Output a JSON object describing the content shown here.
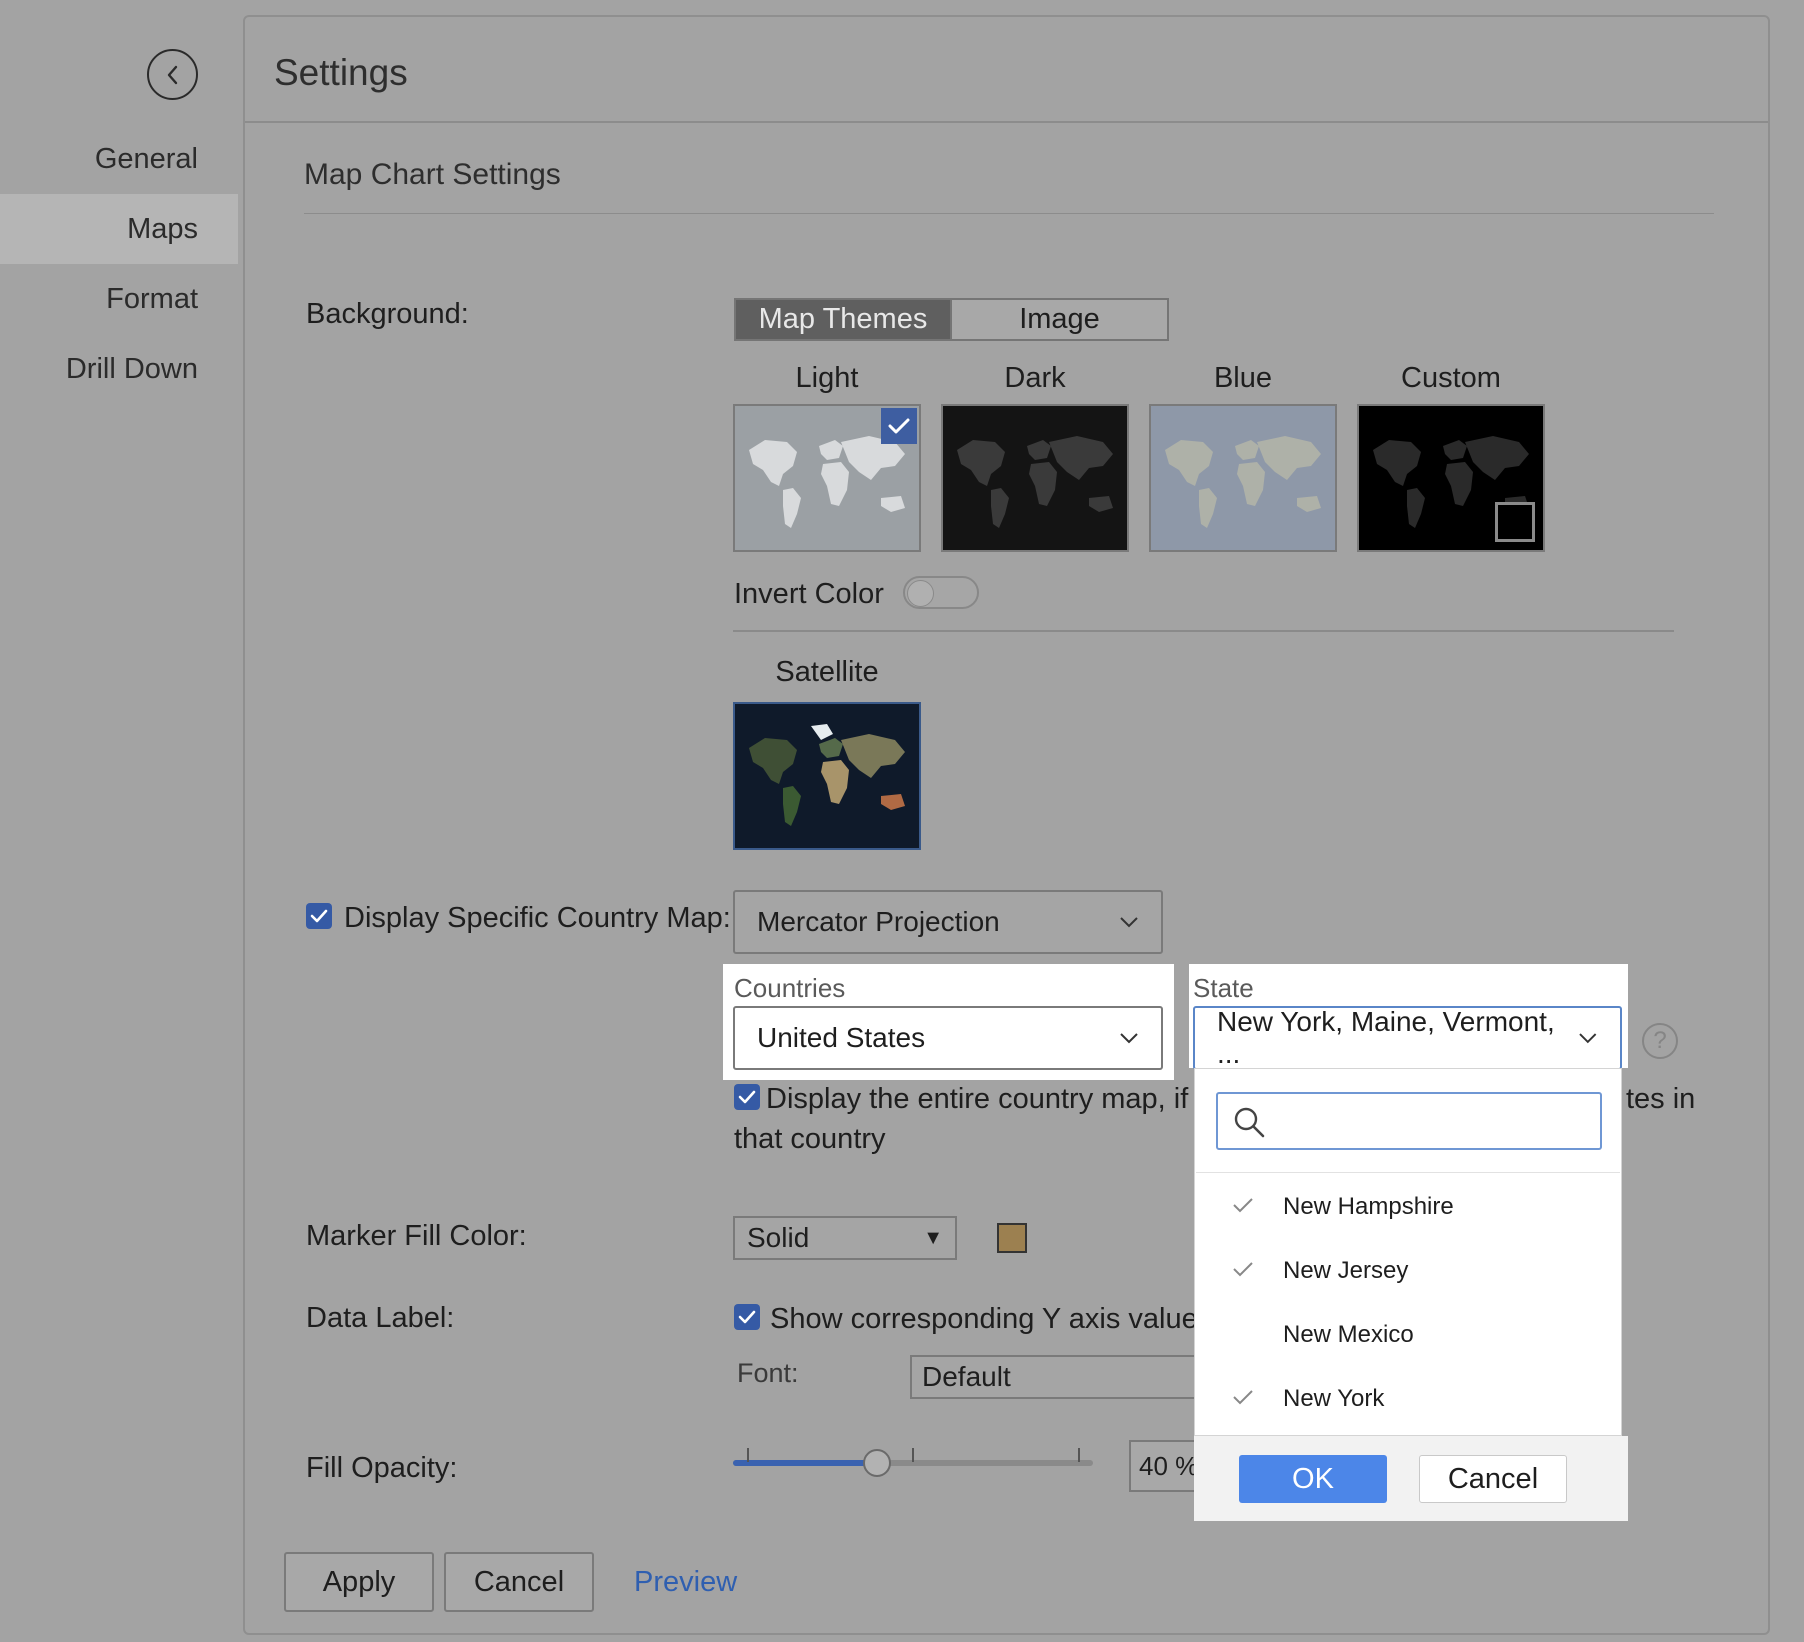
{
  "sidebar": {
    "items": [
      {
        "label": "General"
      },
      {
        "label": "Maps"
      },
      {
        "label": "Format"
      },
      {
        "label": "Drill Down"
      }
    ]
  },
  "header": {
    "title": "Settings"
  },
  "section": {
    "title": "Map Chart Settings"
  },
  "background": {
    "label": "Background:",
    "tabs": [
      "Map Themes",
      "Image"
    ],
    "themes": [
      {
        "label": "Light",
        "selected": true
      },
      {
        "label": "Dark"
      },
      {
        "label": "Blue"
      },
      {
        "label": "Custom"
      }
    ],
    "invert_label": "Invert Color",
    "satellite_label": "Satellite"
  },
  "country_map": {
    "checkbox_label": "Display Specific Country Map:",
    "projection": "Mercator Projection",
    "countries_label": "Countries",
    "country_value": "United States",
    "state_label": "State",
    "state_value": "New York, Maine, Vermont, ...",
    "entire_map_text_1": "Display the entire country map, if th",
    "entire_map_text_end": "tes in",
    "entire_map_text_2": "that country"
  },
  "state_dropdown": {
    "items": [
      {
        "label": "New Hampshire",
        "checked": true
      },
      {
        "label": "New Jersey",
        "checked": true
      },
      {
        "label": "New Mexico",
        "checked": false
      },
      {
        "label": "New York",
        "checked": true
      }
    ],
    "ok_label": "OK",
    "cancel_label": "Cancel"
  },
  "marker": {
    "label": "Marker Fill Color:",
    "fill_type": "Solid",
    "color": "#9c8050"
  },
  "data_label": {
    "label": "Data Label:",
    "checkbox_text": "Show corresponding Y axis value as",
    "font_label": "Font:",
    "font_value": "Default"
  },
  "opacity": {
    "label": "Fill Opacity:",
    "value_text": "40 %",
    "value_fraction": 0.4
  },
  "footer": {
    "apply": "Apply",
    "cancel": "Cancel",
    "preview": "Preview"
  },
  "colors": {
    "accent": "#355aa5",
    "ok_button": "#4c86e8",
    "link": "#2f5fb0"
  }
}
